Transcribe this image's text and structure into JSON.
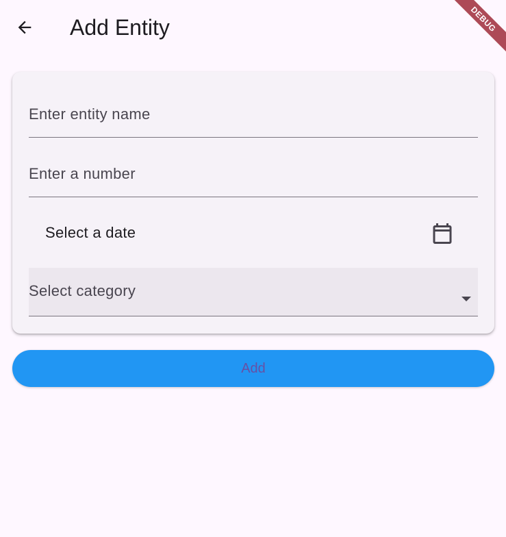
{
  "app_bar": {
    "title": "Add Entity",
    "back_icon": "arrow-back-icon",
    "debug_banner": "DEBUG"
  },
  "form": {
    "name_field": {
      "placeholder": "Enter entity name",
      "value": ""
    },
    "number_field": {
      "placeholder": "Enter a number",
      "value": ""
    },
    "date_picker": {
      "label": "Select a date",
      "icon": "calendar-icon"
    },
    "category_dropdown": {
      "hint": "Select category",
      "icon": "arrow-drop-down-icon"
    }
  },
  "actions": {
    "add_label": "Add"
  },
  "colors": {
    "background": "#fef7ff",
    "card": "#f6f2f8",
    "button": "#2196f3",
    "button_text": "#6750a4",
    "debug_banner": "#a02d3a"
  }
}
